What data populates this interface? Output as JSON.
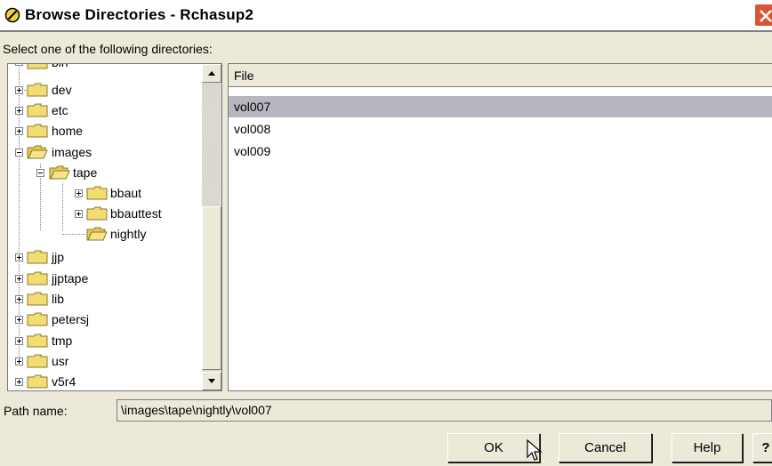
{
  "window": {
    "title": "Browse Directories - Rchasup2",
    "prompt": "Select one of the following directories:"
  },
  "tree": {
    "top_partial": "bin",
    "items": [
      {
        "label": "dev",
        "expanded": false
      },
      {
        "label": "etc",
        "expanded": false
      },
      {
        "label": "home",
        "expanded": false
      },
      {
        "label": "images",
        "expanded": true
      },
      {
        "label": "tape",
        "expanded": true
      },
      {
        "label": "bbaut",
        "expanded": false
      },
      {
        "label": "bbauttest",
        "expanded": false
      },
      {
        "label": "nightly",
        "expanded": true
      },
      {
        "label": "jjp",
        "expanded": false
      },
      {
        "label": "jjptape",
        "expanded": false
      },
      {
        "label": "lib",
        "expanded": false
      },
      {
        "label": "petersj",
        "expanded": false
      },
      {
        "label": "tmp",
        "expanded": false
      },
      {
        "label": "usr",
        "expanded": false
      },
      {
        "label": "v5r4",
        "expanded": false
      }
    ]
  },
  "file_list": {
    "column_header": "File",
    "rows": [
      "vol007",
      "vol008",
      "vol009"
    ],
    "selected": "vol007"
  },
  "path": {
    "label": "Path name:",
    "value": "\\images\\tape\\nightly\\vol007"
  },
  "buttons": {
    "ok": "OK",
    "cancel": "Cancel",
    "help": "Help",
    "question": "?"
  },
  "icons": {
    "title": "no-entry-icon",
    "close": "close-icon",
    "folder": "folder-icon",
    "open_folder": "open-folder-icon",
    "cursor": "mouse-pointer-icon"
  },
  "colors": {
    "folder": "#f3dc72",
    "selection": "#b8b7c0",
    "close_button": "#d8553a",
    "title_icon": "#d4a017"
  }
}
